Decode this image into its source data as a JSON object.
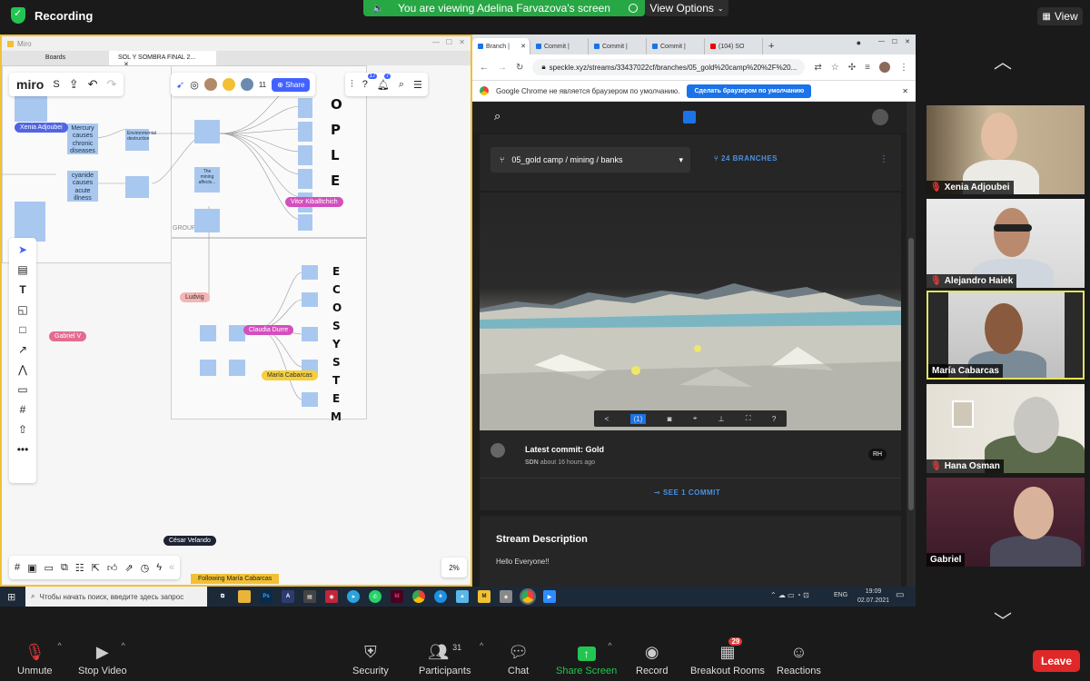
{
  "zoom_top": {
    "recording_label": "Recording",
    "viewing_banner": "You are viewing Adelina Farvazova's screen",
    "view_options_label": "View Options",
    "view_label": "View"
  },
  "miro": {
    "window_title": "Miro",
    "tabs": [
      "Boards",
      "SOL Y SOMBRA FINAL 2..."
    ],
    "logo": "miro",
    "board_initial": "S",
    "collaborator_count": "11",
    "share_label": "Share",
    "notif_count_1": "17",
    "notif_count_2": "7",
    "following_label": "Following María Cabarcas",
    "zoom_level": "2%",
    "group_label": "GROUP 30",
    "letters_people": [
      "O",
      "P",
      "L",
      "E"
    ],
    "letters_ecosystem": [
      "E",
      "C",
      "O",
      "S",
      "Y",
      "S",
      "T",
      "E",
      "M"
    ],
    "stickies": {
      "s1": "Mercury causes chronic diseases",
      "s2": "cyanide causes acute illness",
      "s3": "Environmental destruction",
      "s4": "The mining affects..."
    },
    "cursors": {
      "xenia": "Xenia Adjoubei",
      "vitor": "Vitor Kiballtchich",
      "ludvig": "Ludvig",
      "claudia": "Claudia Durre",
      "gabriel": "Gabriel V",
      "maria": "María Cabarcas",
      "cesar": "César Velando"
    }
  },
  "chrome": {
    "tabs": [
      "Branch |",
      "Commit |",
      "Commit |",
      "Commit |",
      "(104) SO"
    ],
    "url": "speckle.xyz/streams/33437022cf/branches/05_gold%20camp%20%2F%20...",
    "infobar_text": "Google Chrome не является браузером по умолчанию.",
    "infobar_button": "Сделать браузером по умолчанию"
  },
  "speckle": {
    "branch_name": "05_gold camp / mining / banks",
    "branch_count": "24 BRANCHES",
    "viewer_tool_active": "(1)",
    "commit_title": "Latest commit: Gold",
    "commit_author": "SDN",
    "commit_time": "about 16 hours ago",
    "commit_initials": "RH",
    "see_commits": "SEE 1 COMMIT",
    "stream_desc_title": "Stream Description",
    "stream_desc_text": "Hello Everyone!!"
  },
  "taskbar": {
    "search_placeholder": "Чтобы начать поиск, введите здесь запрос",
    "lang": "ENG",
    "time": "19:09",
    "date": "02.07.2021"
  },
  "participants": [
    {
      "name": "Xenia Adjoubei",
      "muted": true
    },
    {
      "name": "Alejandro Haiek",
      "muted": true
    },
    {
      "name": "María Cabarcas",
      "muted": false
    },
    {
      "name": "Hana Osman",
      "muted": true
    },
    {
      "name": "Gabriel",
      "muted": false
    }
  ],
  "zoom_bottom": {
    "unmute": "Unmute",
    "stop_video": "Stop Video",
    "security": "Security",
    "participants": "Participants",
    "participants_count": "31",
    "chat": "Chat",
    "share_screen": "Share Screen",
    "record": "Record",
    "breakout_rooms": "Breakout Rooms",
    "breakout_badge": "29",
    "reactions": "Reactions",
    "leave": "Leave"
  },
  "colors": {
    "zoom_green": "#23c552",
    "leave_red": "#e02828",
    "miro_yellow": "#f2c033",
    "speaking_border": "#e4e35e"
  }
}
